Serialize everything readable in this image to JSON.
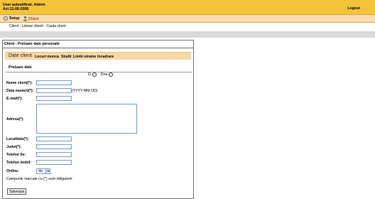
{
  "header": {
    "user_line": "User autentificat: Admin",
    "date_line": "Azi:12-08-2008",
    "logout_label": "Logout"
  },
  "menu": {
    "setup_label": "Setup",
    "client_label": "Client"
  },
  "submenu": {
    "items": [
      "Client",
      ":",
      "Listare clienti",
      ":",
      "Cauta client"
    ]
  },
  "panel": {
    "title": "Client - Preluare date personale",
    "tabs_title": "Date client",
    "tabs": [
      "Locuri munca",
      "Studii",
      "Limbi straine",
      "Incadrare"
    ],
    "section": "Preluare date",
    "radio_labels": [
      "D",
      "Dna"
    ],
    "labels": {
      "nume": "Nume client(*):",
      "data_nasterii": "Data nasterii(*):",
      "email": "E-mail(*):",
      "adresa": "Adresa(*):",
      "localitate": "Localitate(*):",
      "judet": "Judet(*):",
      "telefon_fix": "Telefon fix:",
      "telefon_mobil": "Telefon mobil:",
      "online": "Online:"
    },
    "date_format": "(YYYY-MM-DD)",
    "online_value": "da",
    "note": "Campurile marcate cu (*) sunt obligatorii",
    "save_label": "Salveaza"
  },
  "colors": {
    "header_bg": "#f3c33a",
    "menubar_bg": "#f7ddb0",
    "tab_bg": "#f8d9a6",
    "active_menu": "#c23b00",
    "input_border": "#7a9cc6"
  }
}
